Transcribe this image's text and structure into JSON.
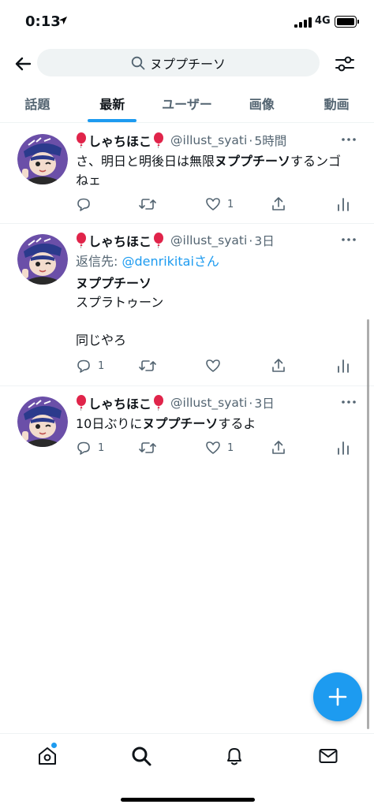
{
  "status_bar": {
    "time": "0:13",
    "network": "4G"
  },
  "search": {
    "query": "ヌププチーソ"
  },
  "tabs": [
    {
      "label": "話題",
      "active": false
    },
    {
      "label": "最新",
      "active": true
    },
    {
      "label": "ユーザー",
      "active": false
    },
    {
      "label": "画像",
      "active": false
    },
    {
      "label": "動画",
      "active": false
    }
  ],
  "tweets": [
    {
      "name": "しゃちほこ",
      "handle": "@illust_syati",
      "time": "5時間",
      "text_before": "さ、明日と明後日は無限",
      "text_bold": "ヌププチーソ",
      "text_after": "するンゴねェ",
      "reply_count": "",
      "like_count": "1"
    },
    {
      "name": "しゃちほこ",
      "handle": "@illust_syati",
      "time": "3日",
      "reply_prefix": "返信先: ",
      "reply_mention": "@denrikitaiさん",
      "line1_bold": "ヌププチーソ",
      "line2": "スプラトゥーン",
      "line3": "同じやろ",
      "reply_count": "1",
      "like_count": ""
    },
    {
      "name": "しゃちほこ",
      "handle": "@illust_syati",
      "time": "3日",
      "text_before": "10日ぶりに",
      "text_bold": "ヌププチーソ",
      "text_after": "するよ",
      "reply_count": "1",
      "like_count": "1"
    }
  ],
  "separator": "·",
  "colors": {
    "accent": "#1d9bf0",
    "muted": "#536471",
    "text": "#0f1419"
  }
}
